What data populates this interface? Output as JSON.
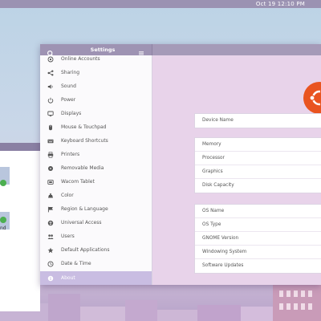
{
  "topbar": {
    "clock": "Oct 19  12:10 PM"
  },
  "background_window": {
    "label": "nd"
  },
  "settings": {
    "title": "Settings",
    "search_icon": "search-icon",
    "menu_icon": "hamburger-menu-icon",
    "accent_color": "#c9bde2",
    "sidebar": [
      {
        "label": "Online Accounts",
        "icon": "at-icon"
      },
      {
        "label": "Sharing",
        "icon": "share-icon"
      },
      {
        "label": "Sound",
        "icon": "speaker-icon"
      },
      {
        "label": "Power",
        "icon": "power-icon"
      },
      {
        "label": "Displays",
        "icon": "monitor-icon"
      },
      {
        "label": "Mouse & Touchpad",
        "icon": "mouse-icon"
      },
      {
        "label": "Keyboard Shortcuts",
        "icon": "keyboard-icon"
      },
      {
        "label": "Printers",
        "icon": "printer-icon"
      },
      {
        "label": "Removable Media",
        "icon": "media-icon"
      },
      {
        "label": "Wacom Tablet",
        "icon": "tablet-icon"
      },
      {
        "label": "Color",
        "icon": "color-icon"
      },
      {
        "label": "Region & Language",
        "icon": "flag-icon"
      },
      {
        "label": "Universal Access",
        "icon": "accessibility-icon"
      },
      {
        "label": "Users",
        "icon": "users-icon"
      },
      {
        "label": "Default Applications",
        "icon": "star-icon"
      },
      {
        "label": "Date & Time",
        "icon": "clock-icon"
      },
      {
        "label": "About",
        "icon": "info-icon",
        "active": true
      }
    ],
    "about": {
      "logo_color": "#e95420",
      "device_group": [
        "Device Name"
      ],
      "hardware_group": [
        "Memory",
        "Processor",
        "Graphics",
        "Disk Capacity"
      ],
      "software_group": [
        "OS Name",
        "OS Type",
        "GNOME Version",
        "Windowing System",
        "Software Updates"
      ]
    }
  }
}
